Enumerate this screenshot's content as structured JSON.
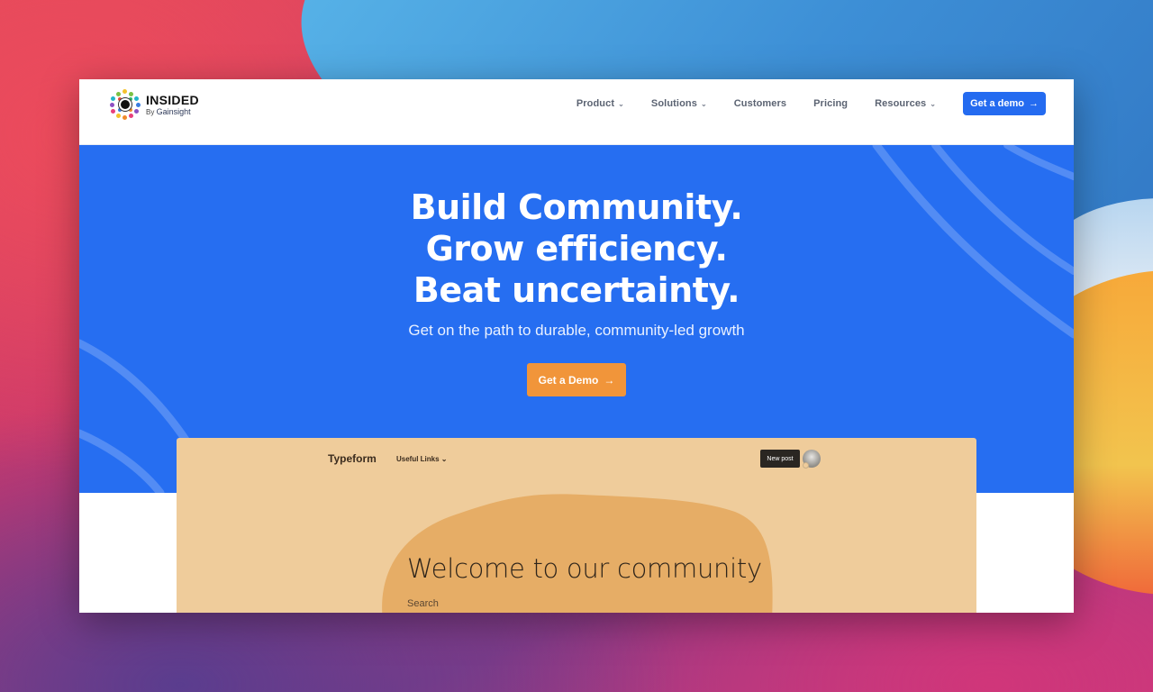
{
  "brand": {
    "logo_word": "INSIDED",
    "logo_by": "By",
    "logo_parent": "Gainsight",
    "colors": {
      "primary": "#266ef1",
      "cta_orange": "#f1953a",
      "preview_bg": "#efcc9b"
    }
  },
  "nav": {
    "items": [
      {
        "label": "Product",
        "has_dropdown": true,
        "icon": "chevron-down-icon"
      },
      {
        "label": "Solutions",
        "has_dropdown": true,
        "icon": "chevron-down-icon"
      },
      {
        "label": "Customers",
        "has_dropdown": false
      },
      {
        "label": "Pricing",
        "has_dropdown": false
      },
      {
        "label": "Resources",
        "has_dropdown": true,
        "icon": "chevron-down-icon"
      }
    ],
    "cta_label": "Get a demo",
    "cta_icon": "arrow-right-icon",
    "chevron_glyph": "⌄",
    "arrow_glyph": "→"
  },
  "hero": {
    "headline_lines": [
      "Build Community.",
      "Grow efficiency.",
      "Beat uncertainty."
    ],
    "subhead": "Get on the path to durable, community-led growth",
    "cta_label": "Get a Demo",
    "arrow_glyph": "→"
  },
  "preview": {
    "brand": "Typeform",
    "useful_links": "Useful Links ⌄",
    "new_post": "New post",
    "welcome": "Welcome to our community",
    "search_label": "Search"
  }
}
